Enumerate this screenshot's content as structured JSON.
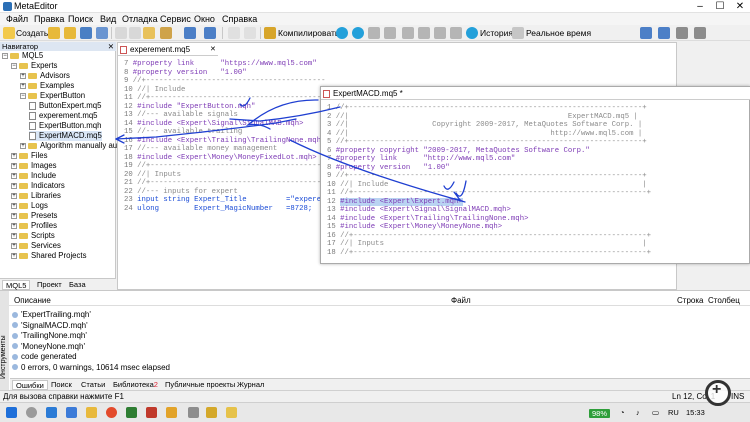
{
  "window": {
    "title": "MetaEditor",
    "controls": [
      "–",
      "☐",
      "✕"
    ]
  },
  "menu": [
    "Файл",
    "Правка",
    "Поиск",
    "Вид",
    "Отладка",
    "Сервис",
    "Окно",
    "Справка"
  ],
  "toolbar": {
    "create": "Создать",
    "compile": "Компилировать",
    "history": "История",
    "realtime": "Реальное время"
  },
  "navigator": {
    "title": "Навигатор",
    "root": "MQL5",
    "items": [
      {
        "label": "Experts",
        "type": "folder",
        "level": 1
      },
      {
        "label": "Advisors",
        "type": "folder",
        "level": 2
      },
      {
        "label": "Examples",
        "type": "folder",
        "level": 2
      },
      {
        "label": "ExpertButton",
        "type": "folder",
        "level": 2
      },
      {
        "label": "ButtonExpert.mq5",
        "type": "file",
        "level": 3
      },
      {
        "label": "experement.mq5",
        "type": "file",
        "level": 3
      },
      {
        "label": "ExpertButton.mqh",
        "type": "file",
        "level": 3
      },
      {
        "label": "ExpertMACD.mq5",
        "type": "file",
        "level": 3
      },
      {
        "label": "Algorithm manually auto",
        "type": "folder",
        "level": 2
      },
      {
        "label": "Files",
        "type": "folder",
        "level": 1
      },
      {
        "label": "Images",
        "type": "folder",
        "level": 1
      },
      {
        "label": "Include",
        "type": "folder",
        "level": 1
      },
      {
        "label": "Indicators",
        "type": "folder",
        "level": 1
      },
      {
        "label": "Libraries",
        "type": "folder",
        "level": 1
      },
      {
        "label": "Logs",
        "type": "folder",
        "level": 1
      },
      {
        "label": "Presets",
        "type": "folder",
        "level": 1
      },
      {
        "label": "Profiles",
        "type": "folder",
        "level": 1
      },
      {
        "label": "Scripts",
        "type": "folder",
        "level": 1
      },
      {
        "label": "Services",
        "type": "folder",
        "level": 1
      },
      {
        "label": "Shared Projects",
        "type": "folder",
        "level": 1
      }
    ],
    "tabs": [
      "MQL5",
      "Проект",
      "База данных"
    ]
  },
  "editor1": {
    "tab": "experement.mq5",
    "lines": [
      {
        "n": "7",
        "t": "#property link      \"https://www.mql5.com\""
      },
      {
        "n": "8",
        "t": "#property version   \"1.00\""
      },
      {
        "n": "9",
        "t": "//+-----------------------------------------"
      },
      {
        "n": "10",
        "t": "//| Include"
      },
      {
        "n": "11",
        "t": "//+-----------------------------------------"
      },
      {
        "n": "12",
        "t": "#include \"ExpertButton.mqh\""
      },
      {
        "n": "13",
        "t": "//--- available signals"
      },
      {
        "n": "14",
        "t": "#include <Expert\\Signal\\SignalMAB.mqh>"
      },
      {
        "n": "15",
        "t": "//--- available trailing"
      },
      {
        "n": "16",
        "t": "#include <Expert\\Trailing\\TrailingNone.mqh>"
      },
      {
        "n": "17",
        "t": "//--- available money management"
      },
      {
        "n": "18",
        "t": "#include <Expert\\Money\\MoneyFixedLot.mqh>"
      },
      {
        "n": "19",
        "t": "//+-----------------------------------------"
      },
      {
        "n": "20",
        "t": "//| Inputs"
      },
      {
        "n": "21",
        "t": "//+-----------------------------------------"
      },
      {
        "n": "22",
        "t": "//--- inputs for expert"
      },
      {
        "n": "23",
        "t": "input string Expert_Title         =\"experement\";"
      },
      {
        "n": "24",
        "t": "ulong        Expert_MagicNumber   =8728;"
      }
    ]
  },
  "editor2": {
    "tab": "ExpertMACD.mq5 *",
    "lines": [
      {
        "n": "1",
        "t": "//+-------------------------------------------------------------------+"
      },
      {
        "n": "2",
        "t": "//|                                                  ExpertMACD.mq5 |"
      },
      {
        "n": "3",
        "t": "//|                   Copyright 2009-2017, MetaQuotes Software Corp. |"
      },
      {
        "n": "4",
        "t": "//|                                              http://www.mql5.com |"
      },
      {
        "n": "5",
        "t": "//+-------------------------------------------------------------------+"
      },
      {
        "n": "6",
        "t": "#property copyright \"2009-2017, MetaQuotes Software Corp.\""
      },
      {
        "n": "7",
        "t": "#property link      \"http://www.mql5.com\""
      },
      {
        "n": "8",
        "t": "#property version   \"1.00\""
      },
      {
        "n": "9",
        "t": "//+-------------------------------------------------------------------+"
      },
      {
        "n": "10",
        "t": "//| Include                                                          |"
      },
      {
        "n": "11",
        "t": "//+-------------------------------------------------------------------+"
      },
      {
        "n": "12",
        "t": "#include <Expert\\Expert.mqh>"
      },
      {
        "n": "13",
        "t": "#include <Expert\\Signal\\SignalMACD.mqh>"
      },
      {
        "n": "14",
        "t": "#include <Expert\\Trailing\\TrailingNone.mqh>"
      },
      {
        "n": "15",
        "t": "#include <Expert\\Money\\MoneyNone.mqh>"
      },
      {
        "n": "16",
        "t": "//+-------------------------------------------------------------------+"
      },
      {
        "n": "17",
        "t": "//| Inputs                                                           |"
      },
      {
        "n": "18",
        "t": "//+-------------------------------------------------------------------+"
      }
    ]
  },
  "toolbox": {
    "side_label": "Инструменты",
    "columns": {
      "description": "Описание",
      "file": "Файл",
      "line": "Строка",
      "column": "Столбец"
    },
    "messages": [
      "'ExpertTrailing.mqh'",
      "'SignalMACD.mqh'",
      "'TrailingNone.mqh'",
      "'MoneyNone.mqh'",
      "code generated",
      "0 errors, 0 warnings, 10614 msec elapsed"
    ],
    "tabs": [
      "Ошибки",
      "Поиск",
      "Статьи",
      "Библиотека",
      "Публичные проекты",
      "Журнал"
    ],
    "library_badge": "2"
  },
  "status": {
    "help": "Для вызова справки нажмите F1",
    "position": "Ln 12, Col 1",
    "mode": "INS"
  },
  "taskbar": {
    "battery": "98%",
    "lang": "RU",
    "time": "15:33"
  },
  "colors": {
    "keyword": "#1a4bd6",
    "string": "#2d8f2d",
    "comment": "#8a8a8a",
    "preprocessor": "#7d3ab5",
    "annotation": "#1f3fd1"
  }
}
